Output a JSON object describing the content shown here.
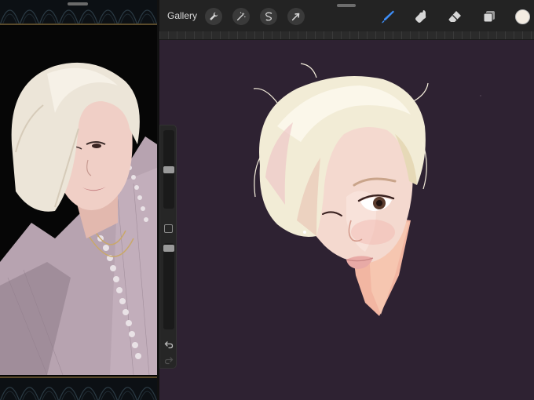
{
  "toolbar": {
    "gallery_label": "Gallery",
    "left_tools": [
      {
        "id": "actions",
        "icon": "wrench-icon"
      },
      {
        "id": "adjustments",
        "icon": "magic-wand-icon"
      },
      {
        "id": "selection",
        "icon": "selection-s-icon"
      },
      {
        "id": "transform",
        "icon": "arrow-cursor-icon"
      }
    ],
    "right_tools": [
      {
        "id": "brush",
        "icon": "brush-icon",
        "active": true
      },
      {
        "id": "smudge",
        "icon": "smudge-icon",
        "active": false
      },
      {
        "id": "eraser",
        "icon": "eraser-icon",
        "active": false
      },
      {
        "id": "layers",
        "icon": "layers-icon",
        "active": false
      }
    ],
    "current_color": "#f3ece2"
  },
  "sidebar": {
    "brush_size": 0.5,
    "brush_opacity": 0.98,
    "undo_enabled": true,
    "redo_enabled": false
  },
  "colors": {
    "canvas_bg": "#2e2232",
    "toolbar_bg": "#232323",
    "active_tool": "#3e8ef7",
    "tool_icon": "#d6d6d6"
  }
}
